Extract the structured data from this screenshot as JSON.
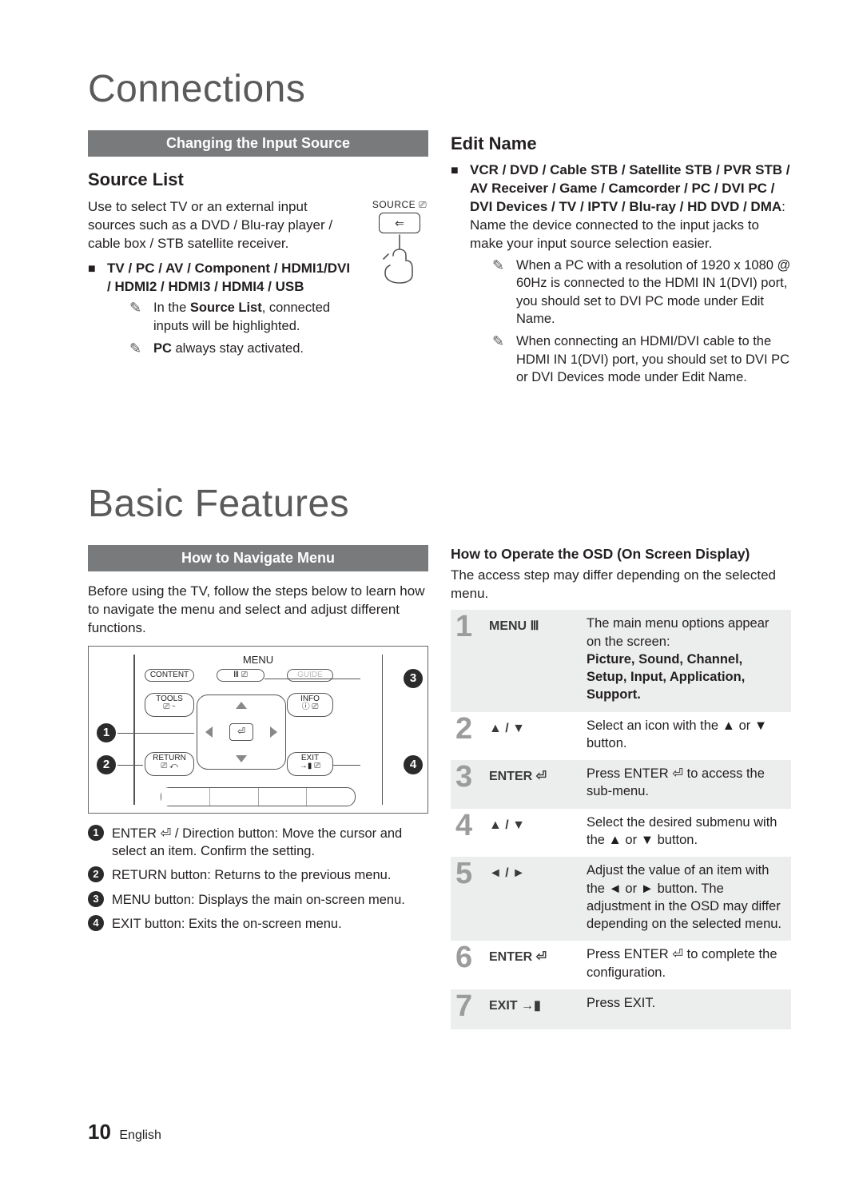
{
  "connections": {
    "heading": "Connections",
    "bar": "Changing the Input Source",
    "source_list": {
      "title": "Source List",
      "intro": "Use to select TV or an external input sources such as a DVD / Blu-ray player / cable box / STB satellite receiver.",
      "source_btn_label": "SOURCE",
      "inputs": "TV / PC / AV / Component / HDMI1/DVI / HDMI2 / HDMI3 / HDMI4 / USB",
      "note1_a": "In the ",
      "note1_b": "Source List",
      "note1_c": ", connected inputs will be highlighted.",
      "note2_a": "PC",
      "note2_b": " always stay activated."
    },
    "edit_name": {
      "title": "Edit Name",
      "list": "VCR / DVD / Cable STB / Satellite STB / PVR STB / AV Receiver / Game / Camcorder / PC /  DVI PC / DVI Devices / TV / IPTV / Blu-ray / HD DVD / DMA",
      "desc": ": Name the device connected to the input jacks to make your input source selection easier.",
      "note1": "When a PC with a resolution of 1920 x 1080 @ 60Hz is connected to the HDMI IN 1(DVI) port, you should set to DVI PC mode under Edit Name.",
      "note2": "When connecting an HDMI/DVI cable to the HDMI IN 1(DVI) port, you should set to DVI PC or DVI Devices mode under Edit Name."
    }
  },
  "basic": {
    "heading": "Basic Features",
    "bar": "How to Navigate Menu",
    "intro": "Before using the TV, follow the steps below to learn how to navigate the menu and select and adjust different functions.",
    "diagram": {
      "menu": "MENU",
      "content": "CONTENT",
      "guide": "GUIDE",
      "tools": "TOOLS",
      "info": "INFO",
      "return": "RETURN",
      "exit": "EXIT"
    },
    "callouts": [
      "ENTER ⏎ / Direction button: Move the cursor and select an item. Confirm the setting.",
      "RETURN button: Returns to the previous menu.",
      "MENU button: Displays the main on-screen menu.",
      "EXIT button: Exits the on-screen menu."
    ],
    "osd_title": "How to Operate the OSD (On Screen Display)",
    "osd_intro": "The access step may differ depending on the selected menu.",
    "steps": [
      {
        "n": "1",
        "key": "MENU Ⅲ",
        "txt_a": "The main menu options appear on the screen:",
        "txt_b": "Picture, Sound, Channel, Setup, Input, Application, Support."
      },
      {
        "n": "2",
        "key": "▲ / ▼",
        "txt_a": "Select an icon with the ▲ or ▼ button.",
        "txt_b": ""
      },
      {
        "n": "3",
        "key": "ENTER ⏎",
        "txt_a": "Press ENTER ⏎ to access the sub-menu.",
        "txt_b": ""
      },
      {
        "n": "4",
        "key": "▲ / ▼",
        "txt_a": "Select the desired submenu with the ▲ or ▼ button.",
        "txt_b": ""
      },
      {
        "n": "5",
        "key": "◄ / ►",
        "txt_a": "Adjust the value of an item with the ◄ or ► button. The adjustment in the OSD may differ depending on the selected menu.",
        "txt_b": ""
      },
      {
        "n": "6",
        "key": "ENTER ⏎",
        "txt_a": "Press ENTER ⏎ to complete the configuration.",
        "txt_b": ""
      },
      {
        "n": "7",
        "key": "EXIT →▮",
        "txt_a": "Press EXIT.",
        "txt_b": ""
      }
    ]
  },
  "footer": {
    "page": "10",
    "lang": "English"
  }
}
